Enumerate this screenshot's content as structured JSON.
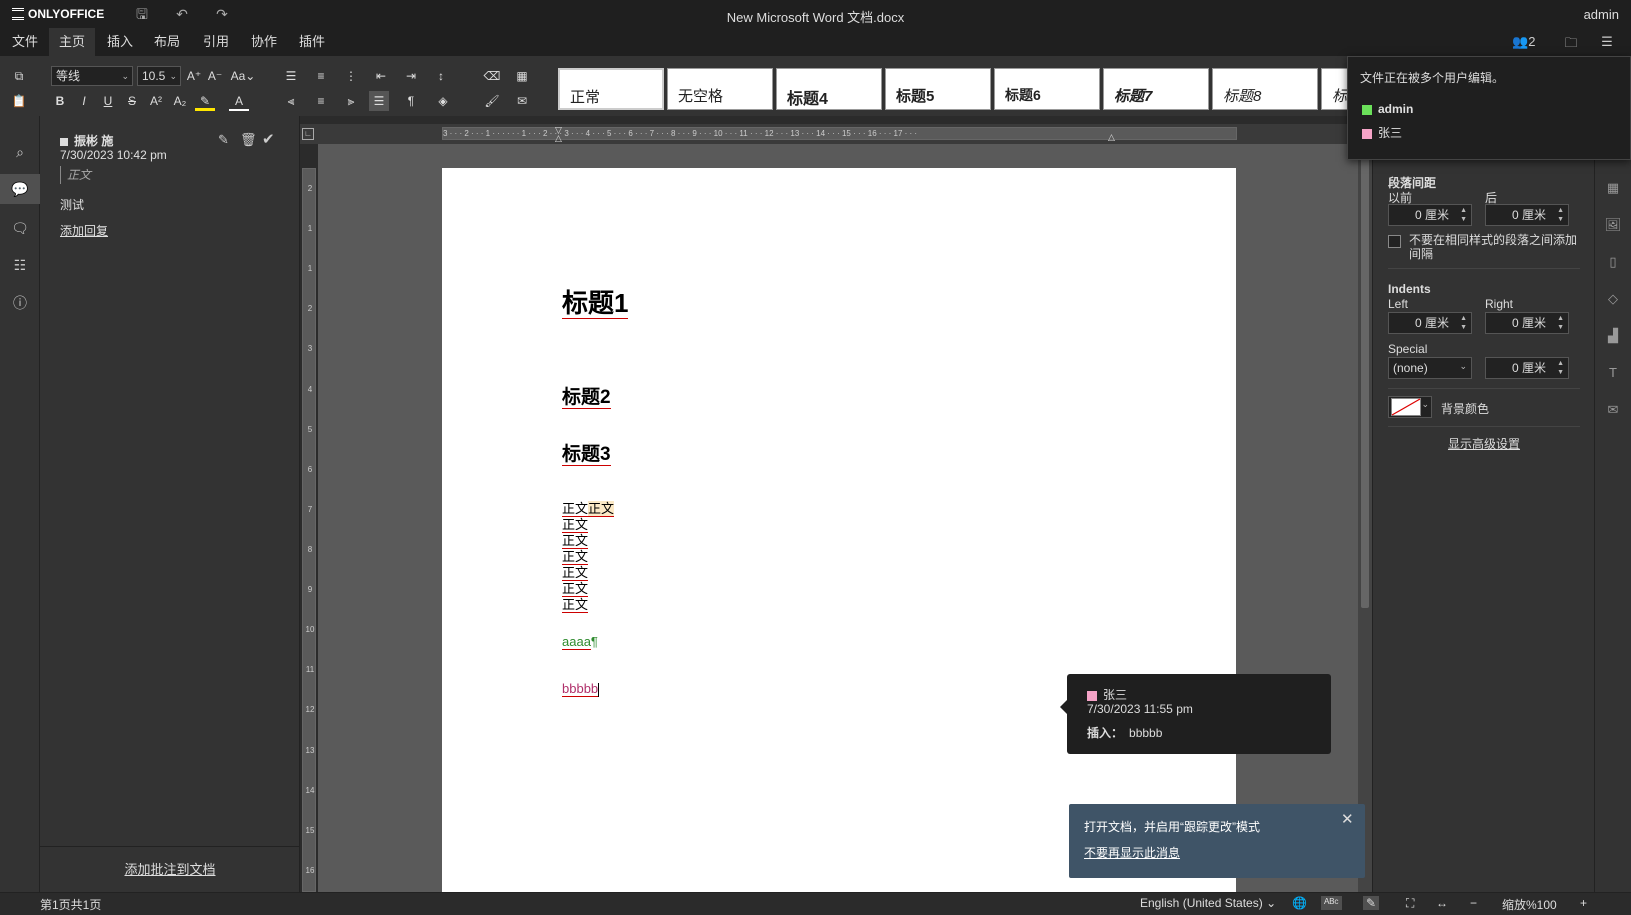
{
  "titlebar": {
    "logo": "ONLYOFFICE",
    "doc_title": "New Microsoft Word 文档.docx",
    "user": "admin"
  },
  "menu": {
    "tabs": [
      "文件",
      "主页",
      "插入",
      "布局",
      "引用",
      "协作",
      "插件"
    ],
    "active": "主页",
    "users_count": "2"
  },
  "toolbar": {
    "font_name": "等线",
    "font_size": "10.5",
    "styles": [
      "正常",
      "无空格",
      "标题4",
      "标题5",
      "标题6",
      "标题7",
      "标题8",
      "标"
    ]
  },
  "comment": {
    "author": "振彬 施",
    "date": "7/30/2023 10:42 pm",
    "quote": "正文",
    "text": "测试",
    "reply_link": "添加回复",
    "add_to_doc": "添加批注到文档"
  },
  "document": {
    "heading1": "标题1",
    "heading2": "标题2",
    "heading3": "标题3",
    "body_first_a": "正文",
    "body_first_b": "正文",
    "body_lines": [
      "正文",
      "正文",
      "正文",
      "正文",
      "正文",
      "正文"
    ],
    "inserted1": "aaaa",
    "pilcrow": "¶",
    "inserted2": "bbbbb"
  },
  "ruler": {
    "h_labels": "3 · · · 2 · · · 1 · · ·  · · · 1 · · · 2 · · · 3 · · · 4 · · · 5 · · · 6 · · · 7 · · · 8 · · · 9 · · · 10 · · · 11 · · · 12 · · · 13 · · · 14 · · · 15 · · · 16 · · · 17 · · ·",
    "v_labels": [
      "2",
      "1",
      "1",
      "2",
      "3",
      "4",
      "5",
      "6",
      "7",
      "8",
      "9",
      "10",
      "11",
      "12",
      "13",
      "14",
      "15",
      "16"
    ]
  },
  "paragraph_settings": {
    "spacing_title": "段落间距",
    "before_label": "以前",
    "after_label": "后",
    "before_value": "0 厘米",
    "after_value": "0 厘米",
    "no_space_checkbox": "不要在相同样式的段落之间添加间隔",
    "indents_title": "Indents",
    "left_label": "Left",
    "right_label": "Right",
    "left_value": "0 厘米",
    "right_value": "0 厘米",
    "special_label": "Special",
    "special_value": "(none)",
    "special_amount": "0 厘米",
    "background_color": "背景颜色",
    "advanced_link": "显示高级设置"
  },
  "users_popup": {
    "message": "文件正在被多个用户编辑。",
    "users": [
      {
        "name": "admin",
        "color": "#6be05a"
      },
      {
        "name": "张三",
        "color": "#f5a3c7"
      }
    ]
  },
  "revision_popup": {
    "author": "张三",
    "author_color": "#f5a3c7",
    "date": "7/30/2023 11:55 pm",
    "action_label": "插入：",
    "action_text": "bbbbb"
  },
  "notification": {
    "message": "打开文档，并启用“跟踪更改”模式",
    "dismiss_link": "不要再显示此消息"
  },
  "statusbar": {
    "page_info": "第1页共1页",
    "language": "English (United States)",
    "zoom": "缩放%100"
  },
  "colors": {
    "accent_user1": "#6be05a",
    "accent_user2": "#f5a3c7",
    "spell_underline": "#cc0000",
    "notify_bg": "#3f5467"
  }
}
